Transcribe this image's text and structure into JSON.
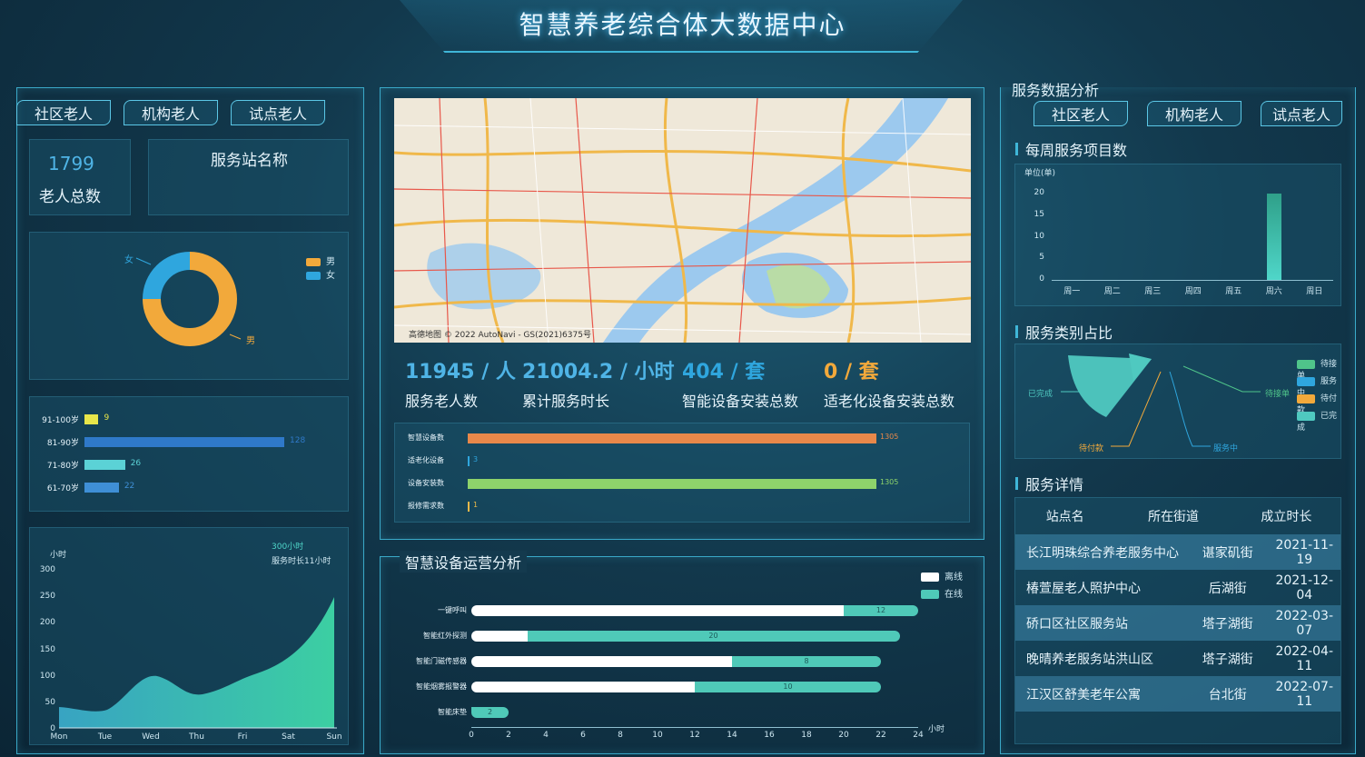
{
  "header": {
    "title": "智慧养老综合体大数据中心"
  },
  "left": {
    "tabs": [
      "社区老人",
      "机构老人",
      "试点老人"
    ],
    "elder_total": {
      "value": "1799",
      "label": "老人总数"
    },
    "station_name_label": "服务站名称",
    "gender_chart": {
      "legend": [
        "男",
        "女"
      ],
      "slices": [
        {
          "name": "男",
          "value": 75,
          "color": "#f2a93b"
        },
        {
          "name": "女",
          "value": 25,
          "color": "#2fa6de"
        }
      ],
      "labels": {
        "male": "男",
        "female": "女"
      }
    },
    "age_chart": {
      "rows": [
        {
          "label": "91-100岁",
          "value": "9",
          "num": 9,
          "color": "#e8e64a"
        },
        {
          "label": "81-90岁",
          "value": "128",
          "num": 128,
          "color": "#2f79c9"
        },
        {
          "label": "71-80岁",
          "value": "26",
          "num": 26,
          "color": "#5bd2d6"
        },
        {
          "label": "61-70岁",
          "value": "22",
          "num": 22,
          "color": "#3f8fd6"
        }
      ]
    },
    "hours_chart": {
      "unit": "小时",
      "annotation_1": "300小时",
      "annotation_2": "服务时长11小时",
      "y_ticks": [
        "300",
        "250",
        "200",
        "150",
        "100",
        "50",
        "0"
      ],
      "x_ticks": [
        "Mon",
        "Tue",
        "Wed",
        "Thu",
        "Fri",
        "Sat",
        "Sun"
      ]
    }
  },
  "map": {
    "attribution": "高德地图 © 2022 AutoNavi - GS(2021)6375号"
  },
  "stats": [
    {
      "value": "11945 / 人",
      "label": "服务老人数",
      "color": "#4fb4e6"
    },
    {
      "value": "21004.2 / 小时",
      "label": "累计服务时长",
      "color": "#4fb4e6"
    },
    {
      "value": "404 / 套",
      "label": "智能设备安装总数",
      "color": "#2fa6de"
    },
    {
      "value": "0 / 套",
      "label": "适老化设备安装总数",
      "color": "#f2a93b"
    }
  ],
  "device_bars": [
    {
      "label": "智慧设备数",
      "value": "1305",
      "num": 1305,
      "color": "#e8884a"
    },
    {
      "label": "适老化设备",
      "value": "3",
      "num": 3,
      "color": "#2fa6de"
    },
    {
      "label": "设备安装数",
      "value": "1305",
      "num": 1305,
      "color": "#8ed36b"
    },
    {
      "label": "报修需求数",
      "value": "1",
      "num": 1,
      "color": "#e8b84a"
    }
  ],
  "ops": {
    "title": "智慧设备运营分析",
    "legend": [
      "离线",
      "在线"
    ],
    "unit": "小时",
    "x_ticks": [
      "0",
      "2",
      "4",
      "6",
      "8",
      "10",
      "12",
      "14",
      "16",
      "18",
      "20",
      "22",
      "24"
    ],
    "rows": [
      {
        "label": "一键呼叫",
        "offline": 20,
        "online": 4,
        "value": "12"
      },
      {
        "label": "智能红外探测",
        "offline": 3,
        "online": 20,
        "value": "20"
      },
      {
        "label": "智能门磁传感器",
        "offline": 14,
        "online": 8,
        "value": "8"
      },
      {
        "label": "智能烟雾报警器",
        "offline": 12,
        "online": 10,
        "value": "10"
      },
      {
        "label": "智能床垫",
        "offline": 0,
        "online": 2,
        "value": "2"
      }
    ]
  },
  "right": {
    "title": "服务数据分析",
    "tabs": [
      "社区老人",
      "机构老人",
      "试点老人"
    ],
    "weekly": {
      "title": "每周服务项目数",
      "unit": "单位(单)",
      "y_ticks": [
        "20",
        "15",
        "10",
        "5",
        "0"
      ],
      "days": [
        "周一",
        "周二",
        "周三",
        "周四",
        "周五",
        "周六",
        "周日"
      ],
      "values": [
        0,
        0,
        0,
        0,
        0,
        20,
        0
      ]
    },
    "category": {
      "title": "服务类别占比",
      "legend": [
        "待接单",
        "服务中",
        "待付款",
        "已完成"
      ],
      "legend_colors": [
        "#4fc48a",
        "#2fa6de",
        "#f2a93b",
        "#4fc9c0"
      ],
      "labels": {
        "completed": "已完成",
        "pending": "待接单",
        "paying": "待付款",
        "serving": "服务中"
      }
    },
    "details": {
      "title": "服务详情",
      "headers": [
        "站点名",
        "所在街道",
        "成立时长"
      ],
      "rows": [
        [
          "长江明珠综合养老服务中心",
          "谌家矶街",
          "2021-11-19"
        ],
        [
          "椿萱屋老人照护中心",
          "后湖街",
          "2021-12-04"
        ],
        [
          "硚口区社区服务站",
          "塔子湖街",
          "2022-03-07"
        ],
        [
          "晚晴养老服务站洪山区",
          "塔子湖街",
          "2022-04-11"
        ],
        [
          "江汉区舒美老年公寓",
          "台北街",
          "2022-07-11"
        ]
      ]
    }
  }
}
